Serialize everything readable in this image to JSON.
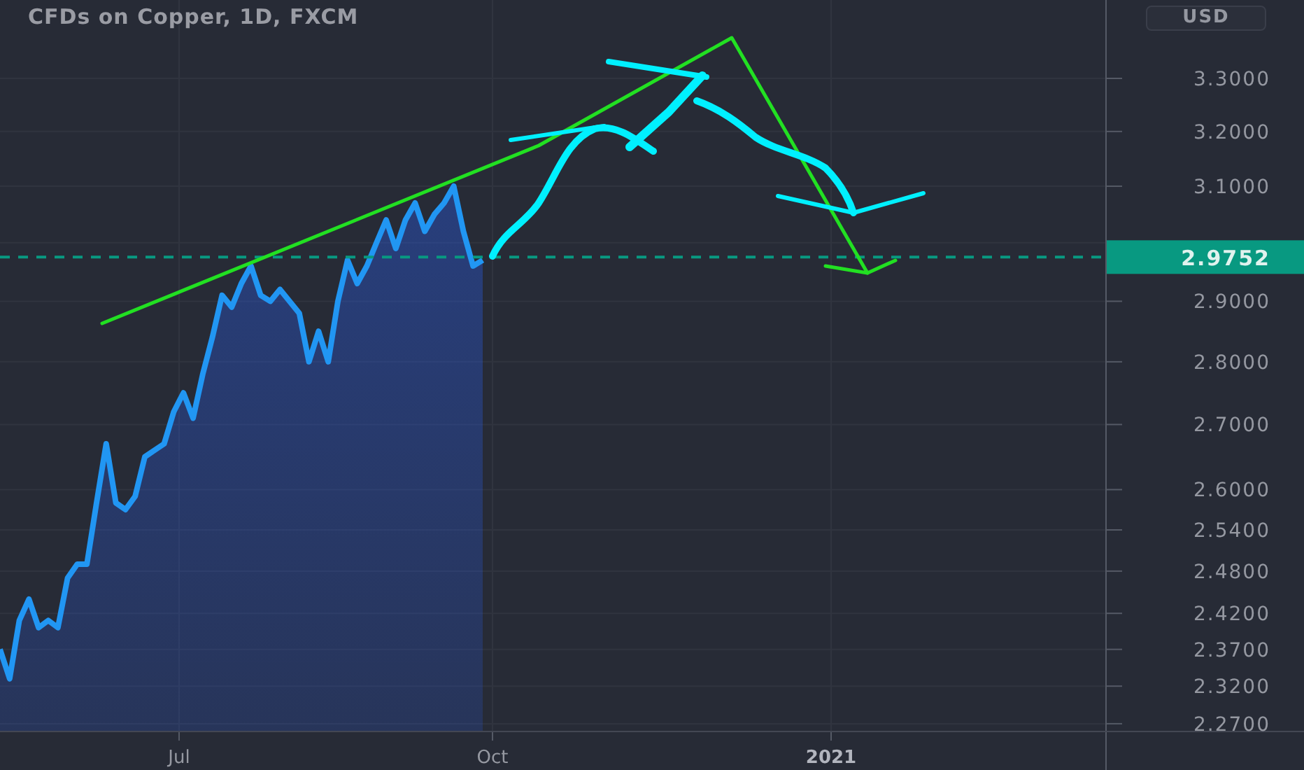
{
  "chart": {
    "title": "CFDs on Copper, 1D, FXCM",
    "currency_button": "USD",
    "price_axis": {
      "labels": [
        "3.3000",
        "3.2000",
        "3.1000",
        "2.9000",
        "2.8000",
        "2.7000",
        "2.6000",
        "2.5400",
        "2.4800",
        "2.4200",
        "2.3700",
        "2.3200",
        "2.2700"
      ]
    },
    "last_price": {
      "label": "2.9752"
    },
    "time_axis": {
      "labels": [
        {
          "text": "Jul",
          "bold": false
        },
        {
          "text": "Oct",
          "bold": false
        },
        {
          "text": "2021",
          "bold": true
        }
      ]
    }
  }
}
